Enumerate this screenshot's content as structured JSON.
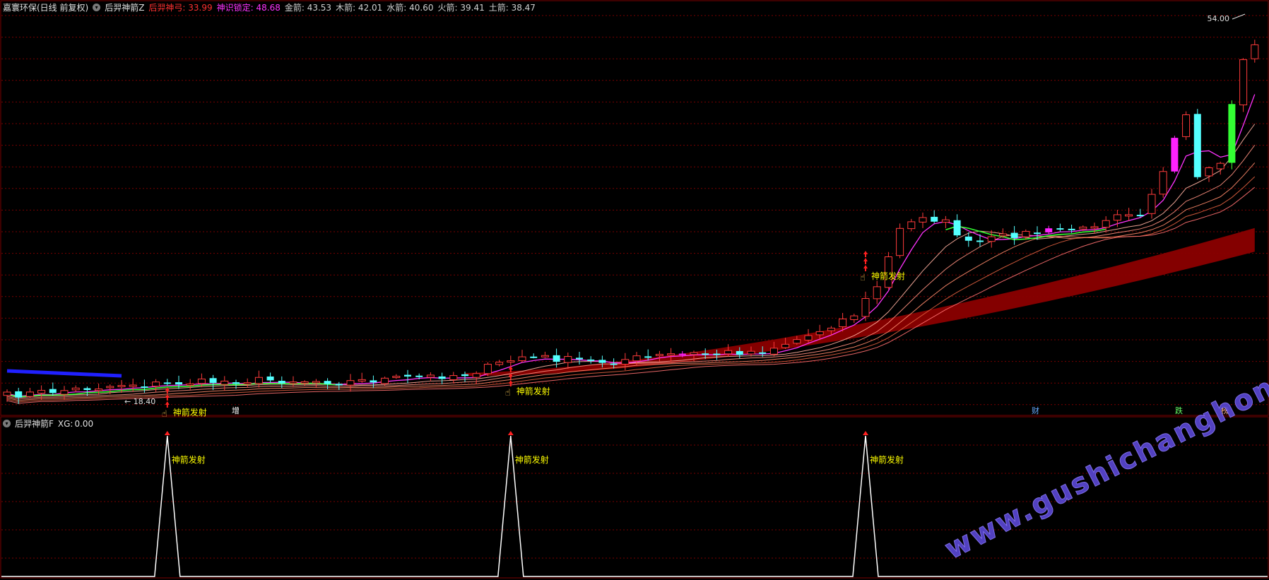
{
  "header": {
    "stock": "嘉寰环保(日线 前复权)",
    "indicator": "后羿神箭Z",
    "items": [
      {
        "label": "后羿神弓:",
        "value": "33.99",
        "color": "#ff3030"
      },
      {
        "label": "神识锁定:",
        "value": "48.68",
        "color": "#ff33ff"
      },
      {
        "label": "金箭:",
        "value": "43.53",
        "color": "#d0d0d0"
      },
      {
        "label": "木箭:",
        "value": "42.01",
        "color": "#d0d0d0"
      },
      {
        "label": "水箭:",
        "value": "40.60",
        "color": "#d0d0d0"
      },
      {
        "label": "火箭:",
        "value": "39.41",
        "color": "#d0d0d0"
      },
      {
        "label": "土箭:",
        "value": "38.47",
        "color": "#d0d0d0"
      }
    ]
  },
  "main": {
    "high_label": "54.00",
    "low_label": "18.40",
    "signal_text": "神箭发射",
    "bottom_markers": [
      "增",
      "财",
      "跌",
      "榜"
    ]
  },
  "sub": {
    "indicator": "后羿神箭F",
    "xg_label": "XG:",
    "xg_value": "0.00",
    "signal_text": "神箭发射"
  },
  "watermark": "www.gushichanghong.com",
  "colors": {
    "up": "#ff3b3b",
    "down": "#54ffff",
    "grid": "#7a0000",
    "signal": "#ffff00",
    "band": "#8b0000"
  },
  "icons": [
    "collapse-circle-icon",
    "hand-pointer-icon",
    "up-arrow-icon"
  ]
}
